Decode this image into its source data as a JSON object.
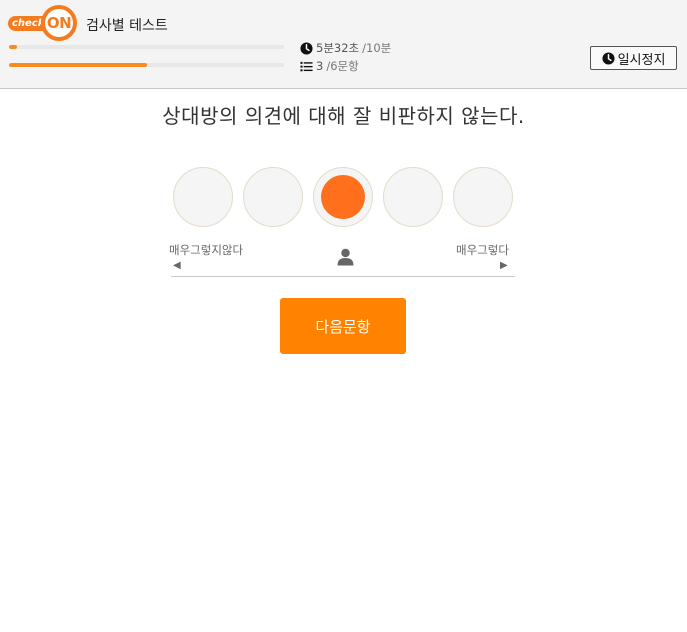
{
  "header": {
    "logo": {
      "left_text": "check",
      "right_text": "ON"
    },
    "test_title": "검사별 테스트",
    "time_progress": 0.03,
    "question_progress": 0.5,
    "time_elapsed": "5분32초",
    "time_limit": "/10분",
    "current_question": "3",
    "total_questions": "/6문항",
    "pause_label": "일시정지"
  },
  "question": {
    "text": "상대방의 의견에 대해 잘 비판하지 않는다."
  },
  "scale": {
    "left_label": "매우그렇지않다",
    "right_label": "매우그렇다",
    "left_arrow": "◀",
    "right_arrow": "▶",
    "options_count": 5,
    "selected_index": 2
  },
  "next_button_label": "다음문항",
  "colors": {
    "accent": "#ff8300",
    "selected": "#ff6f1c",
    "progress": "#f68b1f",
    "logo": "#f47b20"
  },
  "icons": [
    "clock-icon",
    "list-icon",
    "person-icon"
  ]
}
